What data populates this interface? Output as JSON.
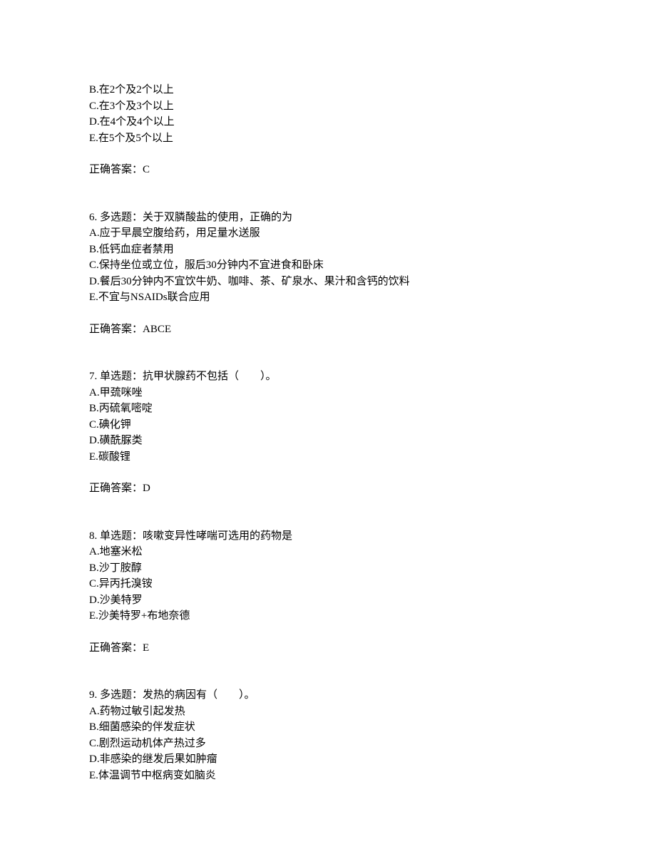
{
  "q5_partial": {
    "options": [
      "B.在2个及2个以上",
      "C.在3个及3个以上",
      "D.在4个及4个以上",
      "E.在5个及5个以上"
    ],
    "answer_label": "正确答案：",
    "answer_value": "C"
  },
  "q6": {
    "number": "6.",
    "type": "多选题：",
    "stem": "关于双膦酸盐的使用，正确的为",
    "options": [
      "A.应于早晨空腹给药，用足量水送服",
      "B.低钙血症者禁用",
      "C.保持坐位或立位，服后30分钟内不宜进食和卧床",
      "D.餐后30分钟内不宜饮牛奶、咖啡、茶、矿泉水、果汁和含钙的饮料",
      "E.不宜与NSAIDs联合应用"
    ],
    "answer_label": "正确答案：",
    "answer_value": "ABCE"
  },
  "q7": {
    "number": "7.",
    "type": "单选题：",
    "stem": "抗甲状腺药不包括（　　）。",
    "options": [
      "A.甲巯咪唑",
      "B.丙硫氧嘧啶",
      "C.碘化钾",
      "D.磺酰脲类",
      "E.碳酸锂"
    ],
    "answer_label": "正确答案：",
    "answer_value": "D"
  },
  "q8": {
    "number": "8.",
    "type": "单选题：",
    "stem": "咳嗽变异性哮喘可选用的药物是",
    "options": [
      "A.地塞米松",
      "B.沙丁胺醇",
      "C.异丙托溴铵",
      "D.沙美特罗",
      "E.沙美特罗+布地奈德"
    ],
    "answer_label": "正确答案：",
    "answer_value": "E"
  },
  "q9": {
    "number": "9.",
    "type": "多选题：",
    "stem": "发热的病因有（　　）。",
    "options": [
      "A.药物过敏引起发热",
      "B.细菌感染的伴发症状",
      "C.剧烈运动机体产热过多",
      "D.非感染的继发后果如肿瘤",
      "E.体温调节中枢病变如脑炎"
    ]
  }
}
